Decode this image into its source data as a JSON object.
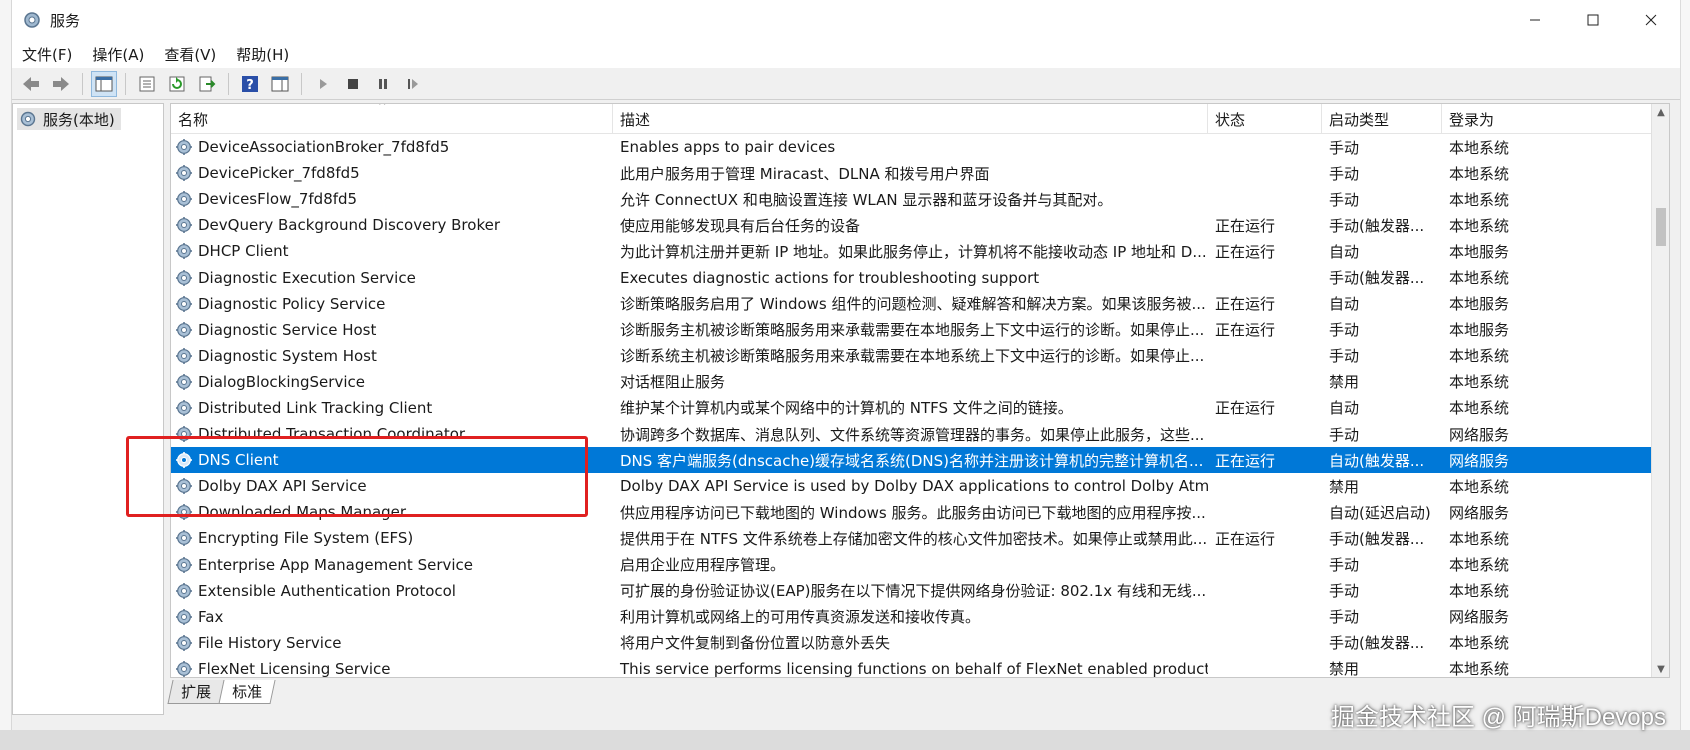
{
  "window": {
    "title": "服务"
  },
  "menu": [
    {
      "label": "文件(F)"
    },
    {
      "label": "操作(A)"
    },
    {
      "label": "查看(V)"
    },
    {
      "label": "帮助(H)"
    }
  ],
  "tree": {
    "root_label": "服务(本地)"
  },
  "columns": {
    "name": "名称",
    "description": "描述",
    "status": "状态",
    "startup": "启动类型",
    "logon": "登录为"
  },
  "rows": [
    {
      "name": "DeviceAssociationBroker_7fd8fd5",
      "description": "Enables apps to pair devices",
      "status": "",
      "startup": "手动",
      "logon": "本地系统"
    },
    {
      "name": "DevicePicker_7fd8fd5",
      "description": "此用户服务用于管理 Miracast、DLNA 和拨号用户界面",
      "status": "",
      "startup": "手动",
      "logon": "本地系统"
    },
    {
      "name": "DevicesFlow_7fd8fd5",
      "description": "允许 ConnectUX 和电脑设置连接 WLAN 显示器和蓝牙设备并与其配对。",
      "status": "",
      "startup": "手动",
      "logon": "本地系统"
    },
    {
      "name": "DevQuery Background Discovery Broker",
      "description": "使应用能够发现具有后台任务的设备",
      "status": "正在运行",
      "startup": "手动(触发器...",
      "logon": "本地系统"
    },
    {
      "name": "DHCP Client",
      "description": "为此计算机注册并更新 IP 地址。如果此服务停止，计算机将不能接收动态 IP 地址和 D...",
      "status": "正在运行",
      "startup": "自动",
      "logon": "本地服务"
    },
    {
      "name": "Diagnostic Execution Service",
      "description": "Executes diagnostic actions for troubleshooting support",
      "status": "",
      "startup": "手动(触发器...",
      "logon": "本地系统"
    },
    {
      "name": "Diagnostic Policy Service",
      "description": "诊断策略服务启用了 Windows 组件的问题检测、疑难解答和解决方案。如果该服务被...",
      "status": "正在运行",
      "startup": "自动",
      "logon": "本地服务"
    },
    {
      "name": "Diagnostic Service Host",
      "description": "诊断服务主机被诊断策略服务用来承载需要在本地服务上下文中运行的诊断。如果停止...",
      "status": "正在运行",
      "startup": "手动",
      "logon": "本地服务"
    },
    {
      "name": "Diagnostic System Host",
      "description": "诊断系统主机被诊断策略服务用来承载需要在本地系统上下文中运行的诊断。如果停止...",
      "status": "",
      "startup": "手动",
      "logon": "本地系统"
    },
    {
      "name": "DialogBlockingService",
      "description": "对话框阻止服务",
      "status": "",
      "startup": "禁用",
      "logon": "本地系统"
    },
    {
      "name": "Distributed Link Tracking Client",
      "description": "维护某个计算机内或某个网络中的计算机的 NTFS 文件之间的链接。",
      "status": "正在运行",
      "startup": "自动",
      "logon": "本地系统"
    },
    {
      "name": "Distributed Transaction Coordinator",
      "description": "协调跨多个数据库、消息队列、文件系统等资源管理器的事务。如果停止此服务，这些...",
      "status": "",
      "startup": "手动",
      "logon": "网络服务"
    },
    {
      "name": "DNS Client",
      "description": "DNS 客户端服务(dnscache)缓存域名系统(DNS)名称并注册该计算机的完整计算机名...",
      "status": "正在运行",
      "startup": "自动(触发器...",
      "logon": "网络服务"
    },
    {
      "name": "Dolby DAX API Service",
      "description": "Dolby DAX API Service is used by Dolby DAX applications to control Dolby Atmos co...",
      "status": "",
      "startup": "禁用",
      "logon": "本地系统"
    },
    {
      "name": "Downloaded Maps Manager",
      "description": "供应用程序访问已下载地图的 Windows 服务。此服务由访问已下载地图的应用程序按...",
      "status": "",
      "startup": "自动(延迟启动)",
      "logon": "网络服务"
    },
    {
      "name": "Encrypting File System (EFS)",
      "description": "提供用于在 NTFS 文件系统卷上存储加密文件的核心文件加密技术。如果停止或禁用此...",
      "status": "正在运行",
      "startup": "手动(触发器...",
      "logon": "本地系统"
    },
    {
      "name": "Enterprise App Management Service",
      "description": "启用企业应用程序管理。",
      "status": "",
      "startup": "手动",
      "logon": "本地系统"
    },
    {
      "name": "Extensible Authentication Protocol",
      "description": "可扩展的身份验证协议(EAP)服务在以下情况下提供网络身份验证: 802.1x 有线和无线...",
      "status": "",
      "startup": "手动",
      "logon": "本地系统"
    },
    {
      "name": "Fax",
      "description": "利用计算机或网络上的可用传真资源发送和接收传真。",
      "status": "",
      "startup": "手动",
      "logon": "网络服务"
    },
    {
      "name": "File History Service",
      "description": "将用户文件复制到备份位置以防意外丢失",
      "status": "",
      "startup": "手动(触发器...",
      "logon": "本地系统"
    },
    {
      "name": "FlexNet Licensing Service",
      "description": "This service performs licensing functions on behalf of FlexNet enabled products.",
      "status": "",
      "startup": "禁用",
      "logon": "本地系统"
    }
  ],
  "selected_row": 12,
  "tabs": [
    {
      "label": "扩展"
    },
    {
      "label": "标准"
    }
  ],
  "watermark": "掘金技术社区 @ 阿瑞斯Devops",
  "colors": {
    "selection": "#0078d7",
    "highlight_box": "#e02020"
  }
}
